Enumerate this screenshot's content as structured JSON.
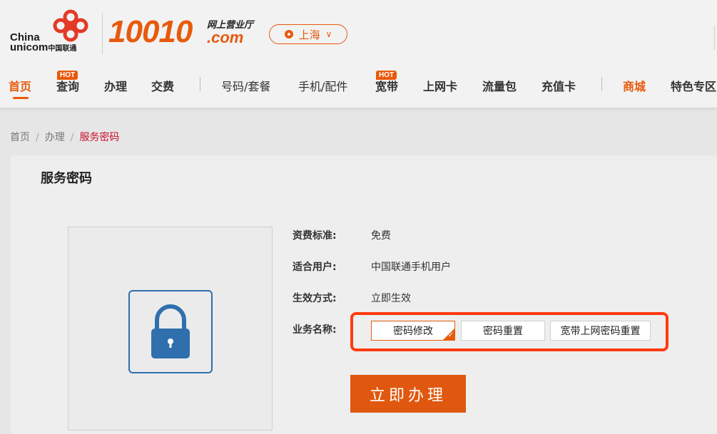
{
  "header": {
    "logo": {
      "en_line1": "China",
      "en_line2": "unicom",
      "cn": "中国联通"
    },
    "brand_number": "10010",
    "brand_sub_top": "网上营业厅",
    "brand_sub_bottom": ".com",
    "city": "上海"
  },
  "nav": {
    "items": [
      {
        "label": "首页"
      },
      {
        "label": "查询",
        "badge": "HOT"
      },
      {
        "label": "办理"
      },
      {
        "label": "交费"
      },
      {
        "label": "号码/套餐"
      },
      {
        "label": "手机/配件"
      },
      {
        "label": "宽带",
        "badge": "HOT"
      },
      {
        "label": "上网卡"
      },
      {
        "label": "流量包"
      },
      {
        "label": "充值卡"
      },
      {
        "label": "商城"
      },
      {
        "label": "特色专区"
      }
    ]
  },
  "breadcrumb": {
    "home": "首页",
    "section": "办理",
    "current": "服务密码",
    "sep": "/"
  },
  "main": {
    "title": "服务密码",
    "fee_label": "资费标准:",
    "fee_value": "免费",
    "users_label": "适合用户:",
    "users_value": "中国联通手机用户",
    "effect_label": "生效方式:",
    "effect_value": "立即生效",
    "business_label": "业务名称:",
    "options": [
      "密码修改",
      "密码重置",
      "宽带上网密码重置"
    ],
    "selected_option": "密码修改",
    "submit": "立即办理"
  },
  "colors": {
    "brand_orange": "#e85a0c",
    "highlight_red": "#ff3b10",
    "lock_blue": "#2f6fad",
    "breadcrumb_red": "#c8102e"
  }
}
